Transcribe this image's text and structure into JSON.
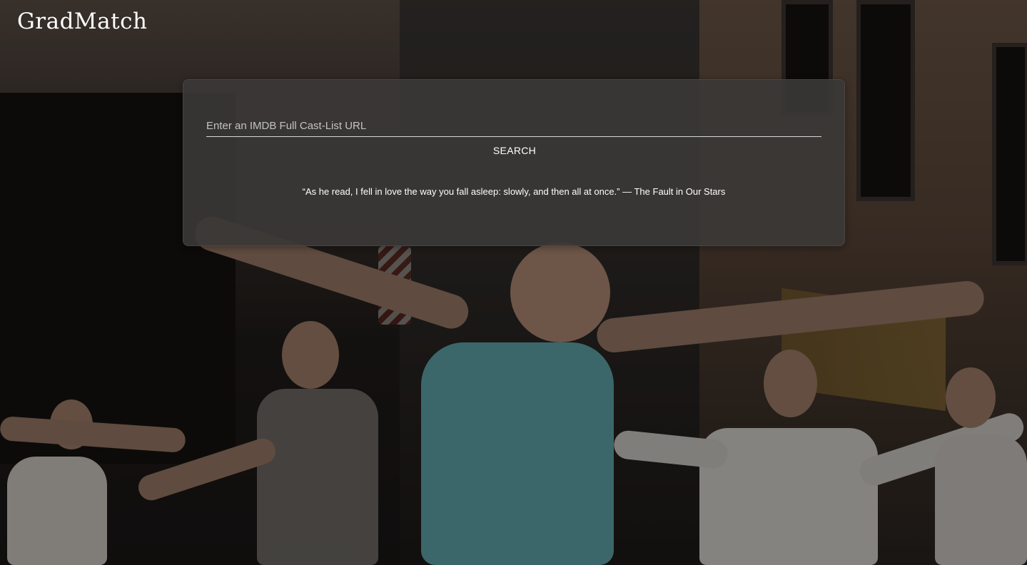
{
  "app": {
    "logo_text": "GradMatch"
  },
  "search": {
    "placeholder": "Enter an IMDB Full Cast-List URL",
    "value": "",
    "button_label": "SEARCH"
  },
  "quote": {
    "text": "“As he read, I fell in love the way you fall asleep: slowly, and then all at once.” — The Fault in Our Stars"
  },
  "colors": {
    "card_background": "#3a3837",
    "text": "#ffffff",
    "placeholder": "#c2c2c2",
    "input_underline": "#d8d8d8"
  }
}
